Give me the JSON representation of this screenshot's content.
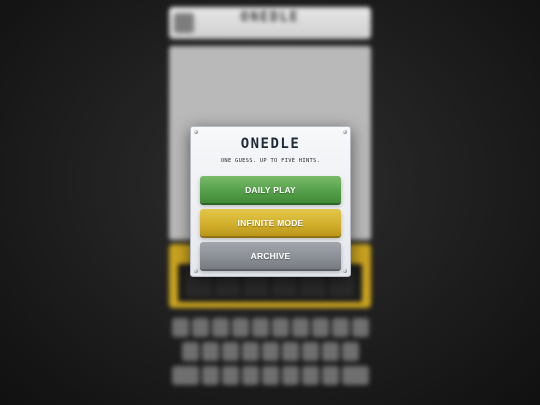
{
  "background_game": {
    "title": "ONEDLE",
    "subtitle": "",
    "keyboard_rows": [
      10,
      9,
      9
    ]
  },
  "modal": {
    "title": "ONEDLE",
    "tagline": "ONE GUESS. UP TO FIVE HINTS.",
    "buttons": {
      "daily": "DAILY PLAY",
      "infinite": "INFINITE MODE",
      "archive": "ARCHIVE"
    }
  },
  "colors": {
    "daily": "#55a04a",
    "infinite": "#d3b02c",
    "archive": "#8b9096",
    "title": "#1d2a3a"
  }
}
